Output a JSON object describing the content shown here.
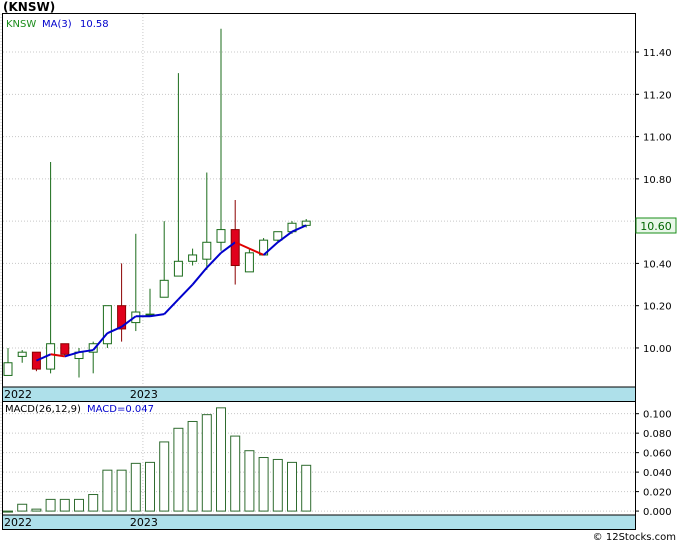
{
  "title": "(KNSW)",
  "footer": "© 12Stocks.com",
  "colors": {
    "up_outline": "#1a6b1a",
    "down_fill": "#e0001c",
    "ma_up": "#0000cc",
    "ma_down": "#e00000",
    "macd_bar": "#2f6b2f",
    "axis_band": "#aee0ea",
    "price_box_fill": "#e8f7e8",
    "price_box_text": "#006600",
    "legend_ticker": "#1a8c1a",
    "legend_ma": "#0000cc"
  },
  "chart_data": [
    {
      "type": "candlestick",
      "legend": {
        "ticker": "KNSW",
        "ma_label": "MA(3)",
        "ma_value": "10.58"
      },
      "last_price": "10.60",
      "x_ticks": [
        "2022",
        "2023"
      ],
      "y_ticks": [
        "10.00",
        "10.20",
        "10.40",
        "10.60",
        "10.80",
        "11.00",
        "11.20",
        "11.40"
      ],
      "ylim": [
        9.82,
        11.58
      ],
      "candles": [
        {
          "o": 9.87,
          "h": 10.0,
          "l": 9.87,
          "c": 9.93
        },
        {
          "o": 9.96,
          "h": 9.99,
          "l": 9.93,
          "c": 9.98
        },
        {
          "o": 9.98,
          "h": 9.98,
          "l": 9.89,
          "c": 9.9
        },
        {
          "o": 9.9,
          "h": 10.88,
          "l": 9.88,
          "c": 10.02
        },
        {
          "o": 10.02,
          "h": 10.02,
          "l": 9.96,
          "c": 9.97
        },
        {
          "o": 9.95,
          "h": 10.0,
          "l": 9.86,
          "c": 9.98
        },
        {
          "o": 9.98,
          "h": 10.03,
          "l": 9.88,
          "c": 10.02
        },
        {
          "o": 10.02,
          "h": 10.2,
          "l": 10.0,
          "c": 10.2
        },
        {
          "o": 10.2,
          "h": 10.4,
          "l": 10.03,
          "c": 10.09
        },
        {
          "o": 10.12,
          "h": 10.54,
          "l": 10.08,
          "c": 10.17
        },
        {
          "o": 10.16,
          "h": 10.28,
          "l": 10.16,
          "c": 10.16
        },
        {
          "o": 10.24,
          "h": 10.6,
          "l": 10.24,
          "c": 10.32
        },
        {
          "o": 10.34,
          "h": 11.3,
          "l": 10.34,
          "c": 10.41
        },
        {
          "o": 10.41,
          "h": 10.47,
          "l": 10.39,
          "c": 10.44
        },
        {
          "o": 10.42,
          "h": 10.83,
          "l": 10.37,
          "c": 10.5
        },
        {
          "o": 10.5,
          "h": 11.51,
          "l": 10.46,
          "c": 10.56
        },
        {
          "o": 10.56,
          "h": 10.7,
          "l": 10.3,
          "c": 10.39
        },
        {
          "o": 10.36,
          "h": 10.47,
          "l": 10.36,
          "c": 10.45
        },
        {
          "o": 10.44,
          "h": 10.52,
          "l": 10.44,
          "c": 10.51
        },
        {
          "o": 10.51,
          "h": 10.55,
          "l": 10.5,
          "c": 10.55
        },
        {
          "o": 10.55,
          "h": 10.6,
          "l": 10.54,
          "c": 10.59
        },
        {
          "o": 10.58,
          "h": 10.61,
          "l": 10.57,
          "c": 10.6
        }
      ],
      "ma": [
        null,
        null,
        9.94,
        9.97,
        9.96,
        9.98,
        9.99,
        10.07,
        10.1,
        10.15,
        10.15,
        10.16,
        10.23,
        10.3,
        10.38,
        10.45,
        10.5,
        10.47,
        10.44,
        10.5,
        10.55,
        10.58
      ]
    },
    {
      "type": "bar",
      "legend": {
        "label": "MACD(26,12,9)",
        "value_label": "MACD=0.047"
      },
      "x_ticks": [
        "2022",
        "2023"
      ],
      "y_ticks": [
        "0.000",
        "0.020",
        "0.040",
        "0.060",
        "0.080",
        "0.100"
      ],
      "ylim": [
        -0.003,
        0.112
      ],
      "values": [
        0.0,
        0.007,
        0.002,
        0.012,
        0.012,
        0.012,
        0.017,
        0.042,
        0.042,
        0.049,
        0.05,
        0.071,
        0.085,
        0.092,
        0.099,
        0.106,
        0.077,
        0.062,
        0.055,
        0.053,
        0.05,
        0.047
      ]
    }
  ]
}
